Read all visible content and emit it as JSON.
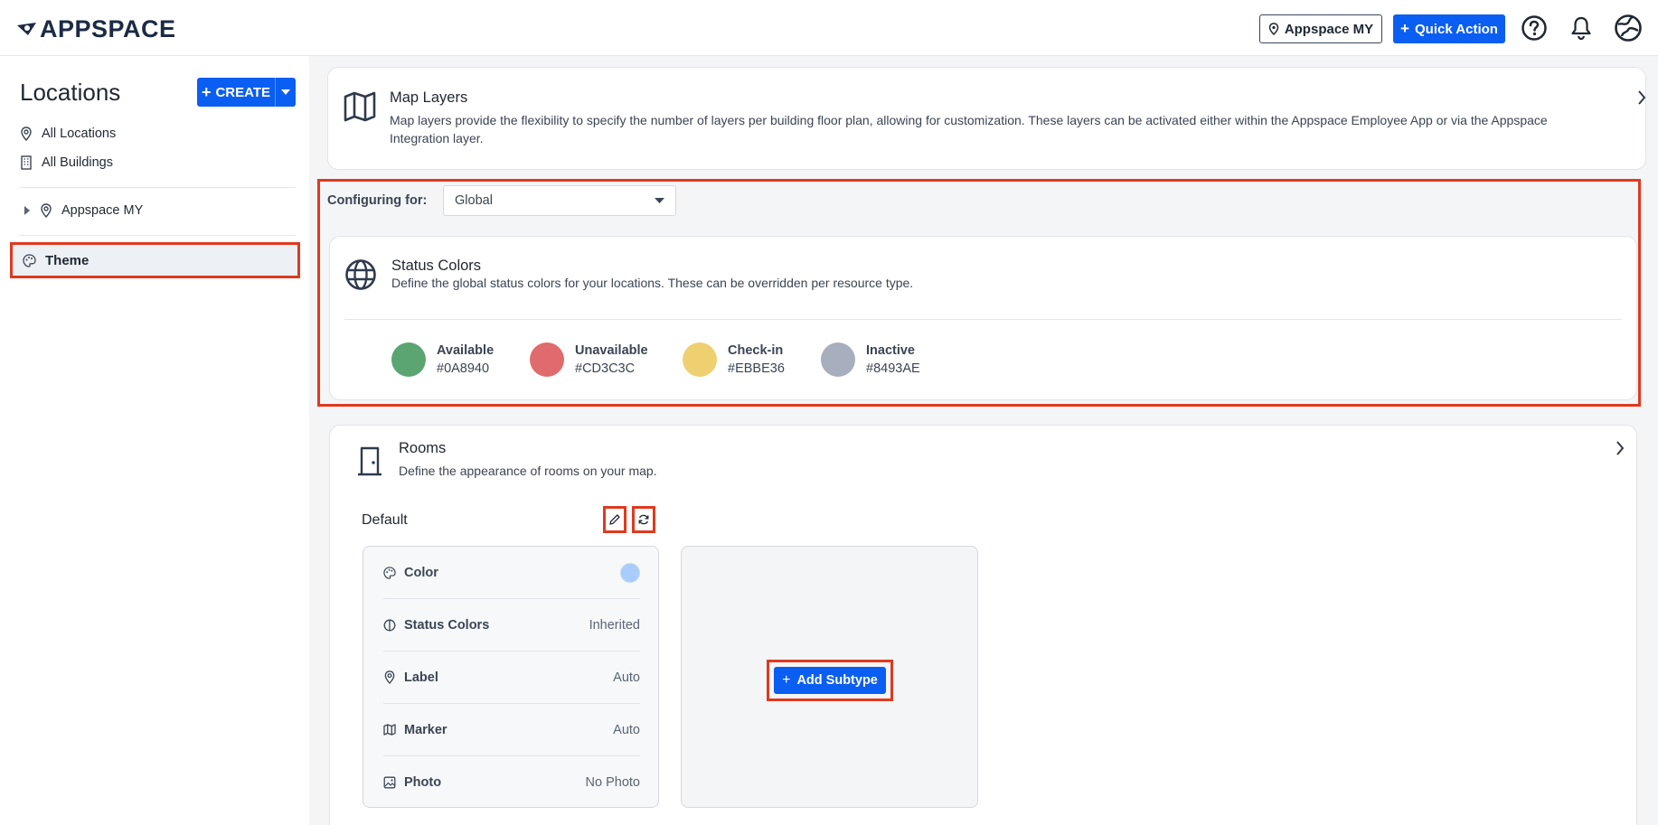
{
  "header": {
    "logo_text": "APPSPACE",
    "location_button": "Appspace MY",
    "quick_action_button": "Quick Action"
  },
  "sidebar": {
    "title": "Locations",
    "create_label": "CREATE",
    "items": [
      {
        "label": "All Locations",
        "icon": "location-pin-icon"
      },
      {
        "label": "All Buildings",
        "icon": "building-icon"
      }
    ],
    "tree_item": "Appspace MY",
    "theme_item": "Theme"
  },
  "map_layers": {
    "title": "Map Layers",
    "description": "Map layers provide the flexibility to specify the number of layers per building floor plan, allowing for customization. These layers can be activated either within the Appspace Employee App or via the Appspace Integration layer."
  },
  "config": {
    "label": "Configuring for:",
    "selected": "Global"
  },
  "status_colors": {
    "title": "Status Colors",
    "description": "Define the global status colors for your locations. These can be overridden per resource type.",
    "items": [
      {
        "name": "Available",
        "hex": "#0A8940",
        "color": "#5aa572"
      },
      {
        "name": "Unavailable",
        "hex": "#CD3C3C",
        "color": "#e06b6e"
      },
      {
        "name": "Check-in",
        "hex": "#EBBE36",
        "color": "#efd071"
      },
      {
        "name": "Inactive",
        "hex": "#8493AE",
        "color": "#a7aebd"
      }
    ]
  },
  "rooms": {
    "title": "Rooms",
    "description": "Define the appearance of rooms on your map.",
    "default_label": "Default",
    "properties": [
      {
        "label": "Color",
        "value": ""
      },
      {
        "label": "Status Colors",
        "value": "Inherited"
      },
      {
        "label": "Label",
        "value": "Auto"
      },
      {
        "label": "Marker",
        "value": "Auto"
      },
      {
        "label": "Photo",
        "value": "No Photo"
      }
    ],
    "add_subtype": "Add Subtype"
  }
}
